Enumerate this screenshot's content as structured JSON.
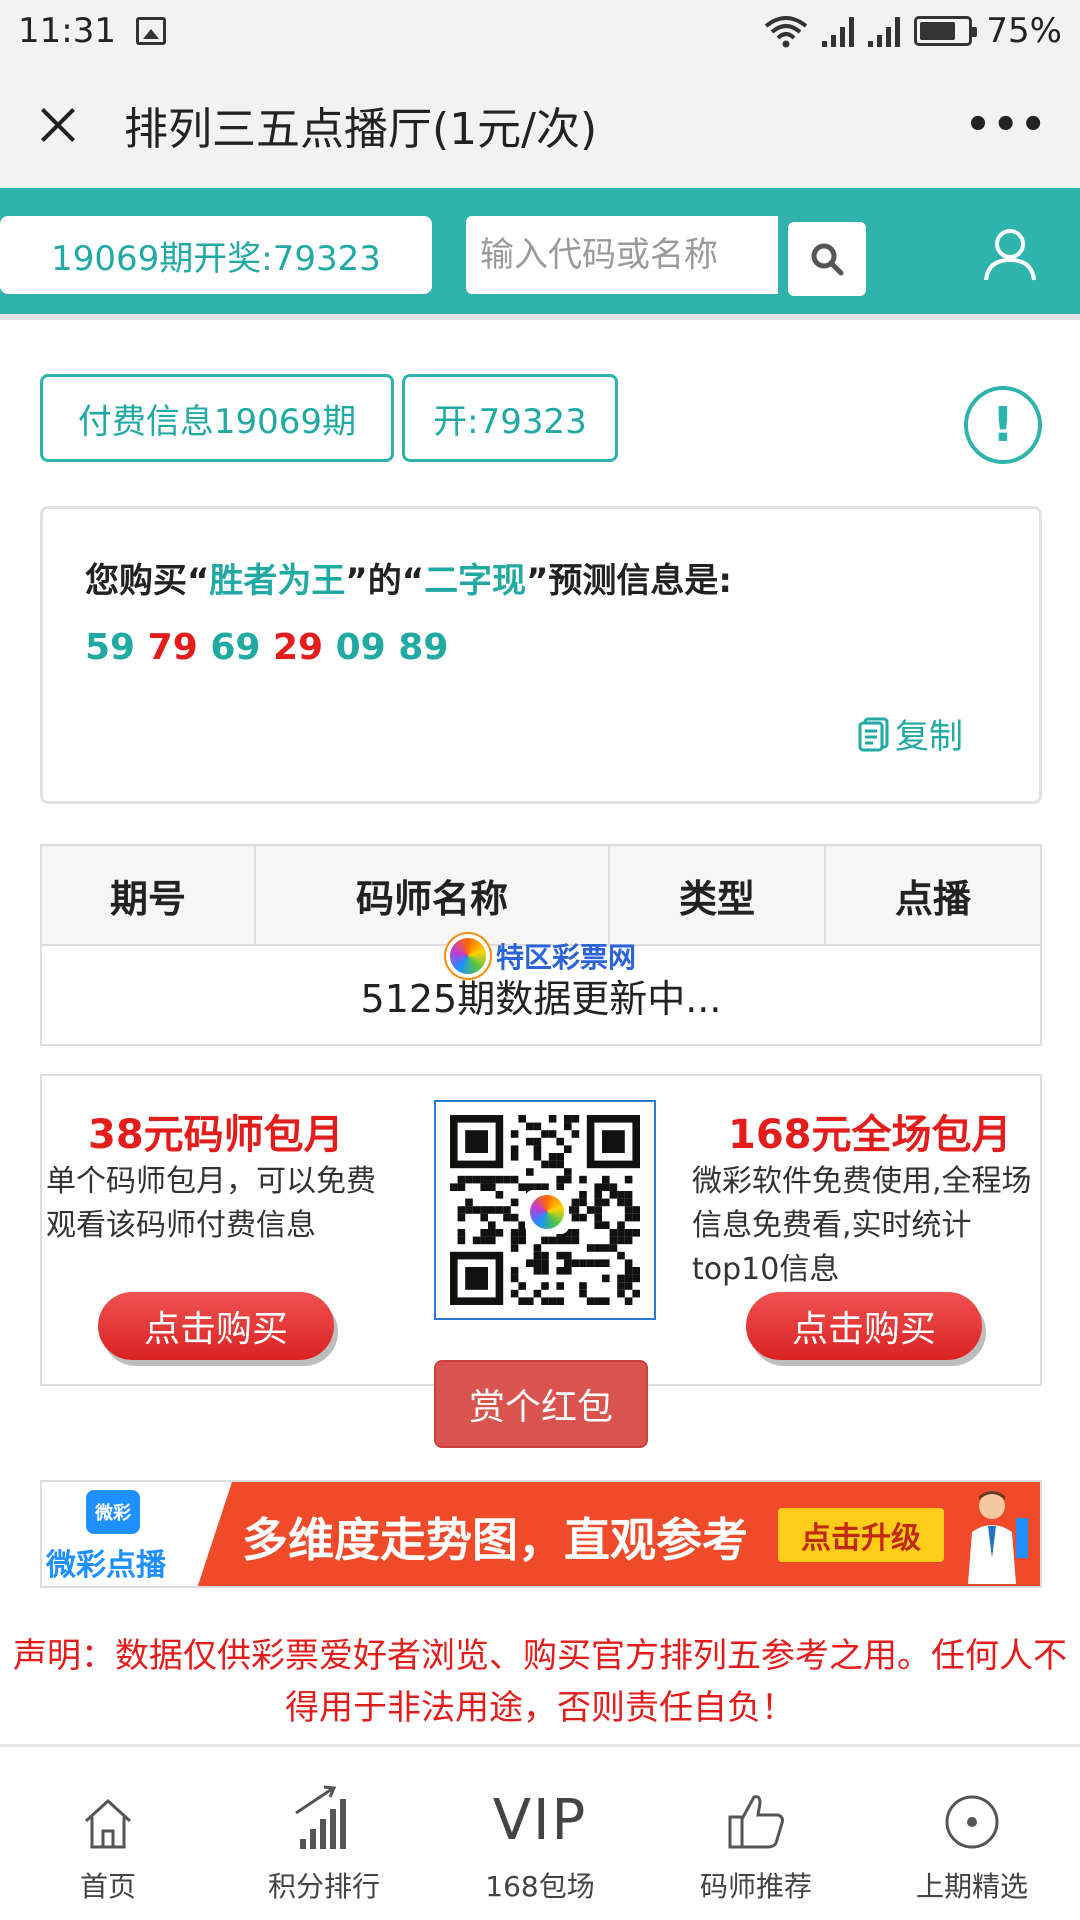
{
  "status_bar": {
    "time": "11:31",
    "battery_percent": "75%",
    "battery_level": 0.75
  },
  "title_bar": {
    "title": "排列三五点播厅(1元/次)",
    "close_icon": "close-icon",
    "more_icon": "more-dots-icon"
  },
  "header": {
    "draw_result": "19069期开奖:79323",
    "search_placeholder": "输入代码或名称",
    "search_icon": "search-icon",
    "user_icon": "user-icon"
  },
  "tags": {
    "paid_info": "付费信息19069期",
    "open_result": "开:79323"
  },
  "info": {
    "prefix": "您购买“",
    "master_name": "胜者为王",
    "middle": "”的“",
    "type_name": "二字现",
    "suffix": "”预测信息是:",
    "numbers": [
      {
        "value": "59",
        "color": "teal"
      },
      {
        "value": "79",
        "color": "red"
      },
      {
        "value": "69",
        "color": "teal"
      },
      {
        "value": "29",
        "color": "red"
      },
      {
        "value": "09",
        "color": "teal"
      },
      {
        "value": "89",
        "color": "teal"
      }
    ],
    "copy_label": "复制"
  },
  "table": {
    "headers": [
      "期号",
      "码师名称",
      "类型",
      "点播"
    ],
    "status_row": "5125期数据更新中...",
    "watermark": "特区彩票网"
  },
  "promo": {
    "left_title": "38元码师包月",
    "left_desc": "单个码师包月，可以免费观看该码师付费信息",
    "right_title": "168元全场包月",
    "right_desc": "微彩软件免费使用,全程场信息免费看,实时统计top10信息",
    "buy_label": "点击购买",
    "redpacket_label": "赏个红包"
  },
  "banner": {
    "logo_icon_text": "微彩",
    "logo_text": "微彩点播",
    "slogan": "多维度走势图，直观参考",
    "cta": "点击升级"
  },
  "disclaimer": "声明：数据仅供彩票爱好者浏览、购买官方排列五参考之用。任何人不得用于非法用途，否则责任自负！",
  "bottom_nav": [
    {
      "label": "首页",
      "icon": "home-icon"
    },
    {
      "label": "积分排行",
      "icon": "ranking-icon"
    },
    {
      "label": "168包场",
      "icon": "vip-icon",
      "icon_text": "VIP"
    },
    {
      "label": "码师推荐",
      "icon": "thumbs-up-icon"
    },
    {
      "label": "上期精选",
      "icon": "record-icon"
    }
  ],
  "colors": {
    "teal": "#2eb3ad",
    "red": "#e31c1c",
    "button_red": "#d9534f"
  }
}
